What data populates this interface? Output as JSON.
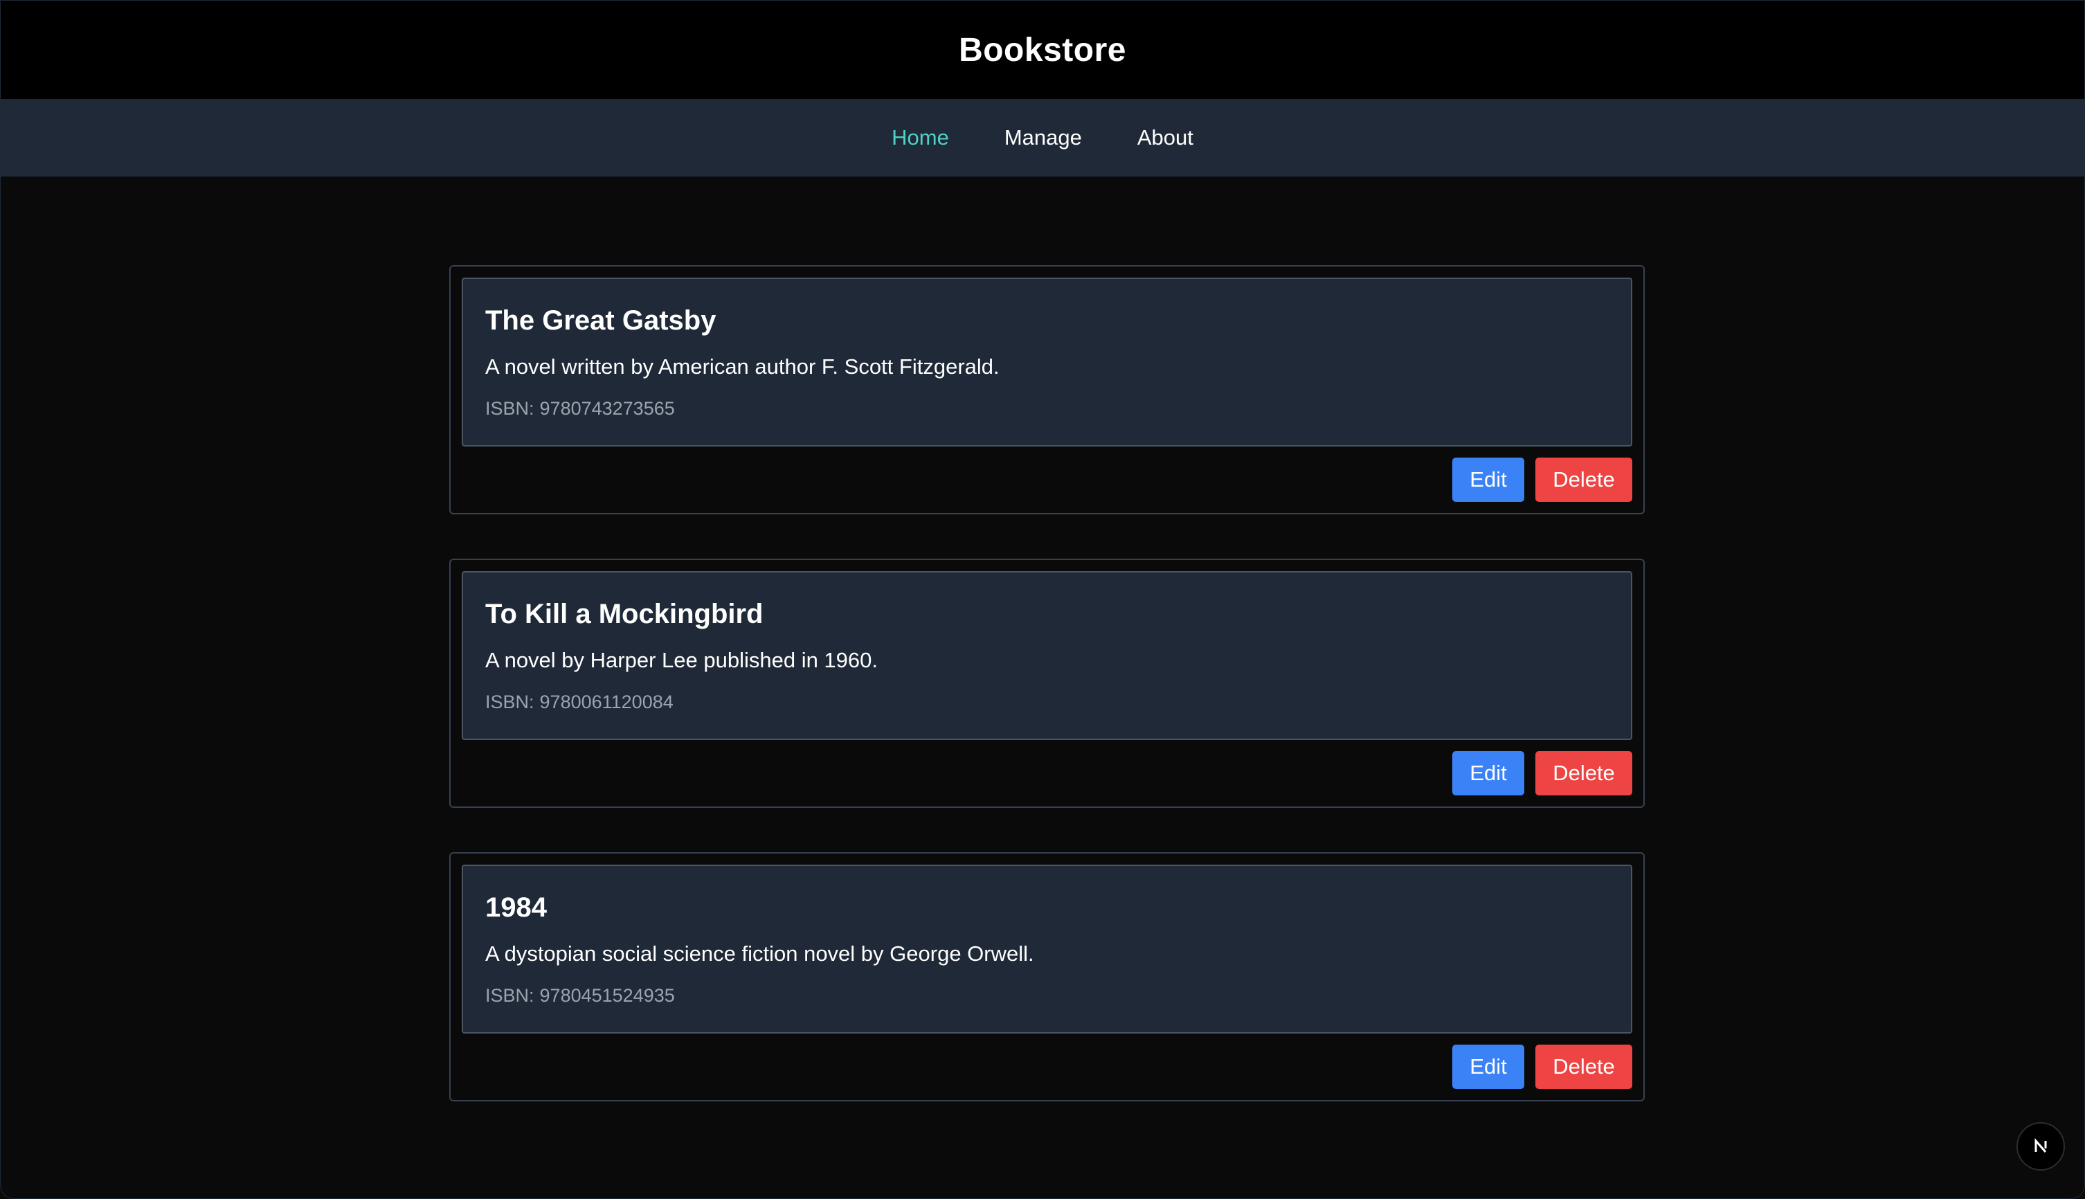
{
  "header": {
    "title": "Bookstore"
  },
  "nav": {
    "items": [
      {
        "label": "Home",
        "active": true
      },
      {
        "label": "Manage",
        "active": false
      },
      {
        "label": "About",
        "active": false
      }
    ]
  },
  "books": [
    {
      "title": "The Great Gatsby",
      "description": "A novel written by American author F. Scott Fitzgerald.",
      "isbn_label": "ISBN:",
      "isbn": "9780743273565",
      "edit_label": "Edit",
      "delete_label": "Delete"
    },
    {
      "title": "To Kill a Mockingbird",
      "description": "A novel by Harper Lee published in 1960.",
      "isbn_label": "ISBN:",
      "isbn": "9780061120084",
      "edit_label": "Edit",
      "delete_label": "Delete"
    },
    {
      "title": "1984",
      "description": "A dystopian social science fiction novel by George Orwell.",
      "isbn_label": "ISBN:",
      "isbn": "9780451524935",
      "edit_label": "Edit",
      "delete_label": "Delete"
    }
  ],
  "dev_badge": {
    "icon": "nextjs-logo-icon"
  },
  "colors": {
    "page_bg": "#0a0a0a",
    "header_bg": "#000000",
    "nav_bg": "#1f2937",
    "nav_active": "#4fd1c5",
    "card_inner_bg": "#1f2937",
    "edit_button": "#3b82f6",
    "delete_button": "#ef4444",
    "isbn_text": "#9ca3af"
  }
}
